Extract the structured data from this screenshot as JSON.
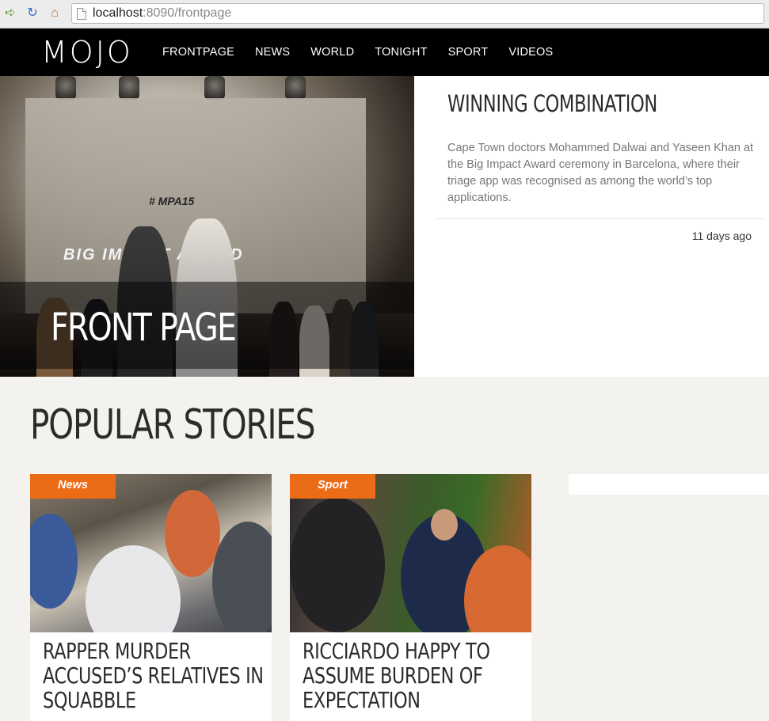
{
  "browser": {
    "url_host": "localhost",
    "url_rest": ":8090/frontpage",
    "back_icon": "back-arrow-icon",
    "reload_icon": "reload-icon",
    "home_icon": "home-icon"
  },
  "site": {
    "logo": "MOJO",
    "nav": [
      "FRONTPAGE",
      "NEWS",
      "WORLD",
      "TONIGHT",
      "SPORT",
      "VIDEOS"
    ]
  },
  "hero": {
    "title": "FRONT PAGE",
    "screen_hashtag": "# MPA15",
    "screen_caption": "BIG IMPACT AWARD"
  },
  "feature": {
    "title": "WINNING COMBINATION",
    "summary": "Cape Town doctors Mohammed Dalwai and Yaseen Khan at the Big Impact Award ceremony in Barcelona, where their triage app was recognised as among the world’s top applications.",
    "time": "11 days ago"
  },
  "popular": {
    "title": "POPULAR STORIES",
    "stories": [
      {
        "category": "News",
        "headline_lines": [
          "RAPPER MURDER",
          "ACCUSED’S RELATIVES IN",
          "SQUABBLE"
        ]
      },
      {
        "category": "Sport",
        "headline_lines": [
          "RICCIARDO HAPPY TO",
          "ASSUME BURDEN OF",
          "EXPECTATION"
        ]
      }
    ]
  },
  "colors": {
    "accent": "#ec6b17",
    "header_bg": "#000000",
    "page_bg": "#f4f2ee"
  }
}
